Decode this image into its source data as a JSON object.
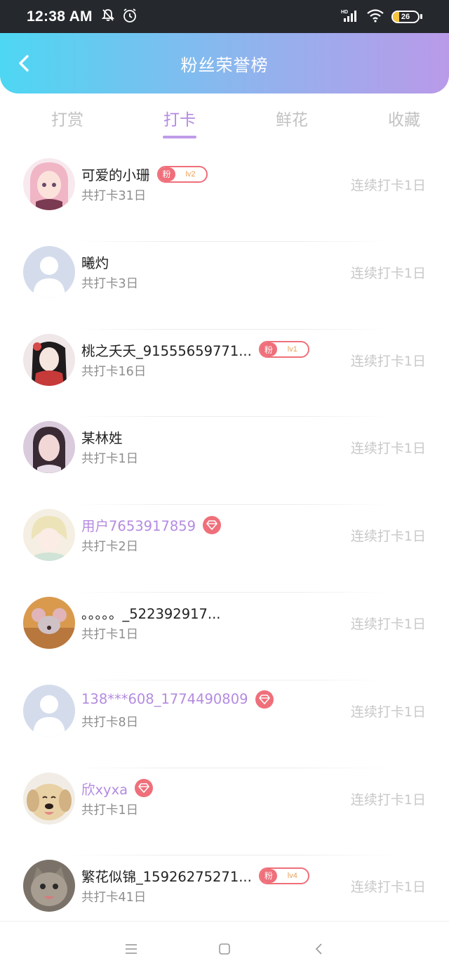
{
  "status_bar": {
    "time": "12:38 AM",
    "battery": "26",
    "battery_level": 0.26,
    "icons": [
      "bell-off-icon",
      "alarm-icon",
      "hd-signal-icon",
      "wifi-icon",
      "battery-icon"
    ]
  },
  "header": {
    "title": "粉丝荣誉榜",
    "back_icon": "chevron-left-icon",
    "gradient": [
      "#4dd7f2",
      "#b99ae9"
    ]
  },
  "tabs": [
    {
      "label": "打赏",
      "active": false
    },
    {
      "label": "打卡",
      "active": true
    },
    {
      "label": "鲜花",
      "active": false
    },
    {
      "label": "收藏",
      "active": false
    }
  ],
  "accent_color": "#b48be0",
  "badge_color": "#ef6f7a",
  "fans": [
    {
      "name": "可爱的小珊",
      "count": "共打卡31日",
      "streak": "连续打卡1日",
      "badge": "fan",
      "badge_label": "粉",
      "badge_level": "lv2",
      "avatar": "anime-girl-pink-avatar"
    },
    {
      "name": "曦灼",
      "count": "共打卡3日",
      "streak": "连续打卡1日",
      "badge": "none",
      "avatar": "default-user-avatar"
    },
    {
      "name": "桃之夭夭_91555659771...",
      "count": "共打卡16日",
      "streak": "连续打卡1日",
      "badge": "fan",
      "badge_label": "粉",
      "badge_level": "lv1",
      "avatar": "anime-girl-red-avatar"
    },
    {
      "name": "某林姓",
      "count": "共打卡1日",
      "streak": "连续打卡1日",
      "badge": "none",
      "avatar": "woman-photo-avatar"
    },
    {
      "name": "用户7653917859",
      "count": "共打卡2日",
      "streak": "连续打卡1日",
      "badge": "vip",
      "avatar": "anime-boy-avatar"
    },
    {
      "name": "。。。。。_522392917...",
      "count": "共打卡1日",
      "streak": "连续打卡1日",
      "badge": "none",
      "avatar": "cartoon-mouse-avatar"
    },
    {
      "name": "138***608_1774490809",
      "count": "共打卡8日",
      "streak": "连续打卡1日",
      "badge": "vip",
      "avatar": "default-user-avatar"
    },
    {
      "name": "欣xyxa",
      "count": "共打卡1日",
      "streak": "连续打卡1日",
      "badge": "vip",
      "avatar": "puppy-avatar"
    },
    {
      "name": "繁花似锦_15926275271...",
      "count": "共打卡41日",
      "streak": "连续打卡1日",
      "badge": "fan",
      "badge_label": "粉",
      "badge_level": "lv4",
      "avatar": "kitten-avatar"
    }
  ],
  "nav_bar": {
    "items": [
      "menu-icon",
      "home-square-icon",
      "back-triangle-icon"
    ]
  }
}
